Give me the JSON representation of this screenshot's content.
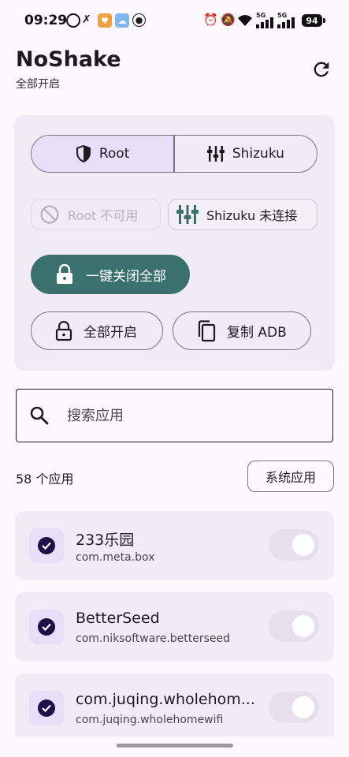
{
  "status_bar": {
    "time": "09:29",
    "signal_1": "5G",
    "signal_2": "5G",
    "battery": "94"
  },
  "header": {
    "title": "NoShake",
    "subtitle": "全部开启"
  },
  "mode_segment": {
    "root_label": "Root",
    "shizuku_label": "Shizuku",
    "selected": "Root"
  },
  "status_chips": {
    "root": "Root 不可用",
    "shizuku": "Shizuku 未连接"
  },
  "actions": {
    "close_all": "一键关闭全部",
    "open_all": "全部开启",
    "copy_adb": "复制 ADB"
  },
  "search": {
    "placeholder": "搜索应用",
    "value": ""
  },
  "list_header": {
    "count": "58 个应用",
    "system_apps": "系统应用"
  },
  "apps": [
    {
      "name": "233乐园",
      "package": "com.meta.box",
      "checked": true,
      "enabled": false
    },
    {
      "name": "BetterSeed",
      "package": "com.niksoftware.betterseed",
      "checked": true,
      "enabled": false
    },
    {
      "name": "com.juqing.wholehom...",
      "package": "com.juqing.wholehomewifi",
      "checked": true,
      "enabled": false
    }
  ],
  "colors": {
    "accent": "#3b716c",
    "selected_segment": "#e8def8",
    "card_background": "#f0ebf4",
    "check": "#1d1148"
  }
}
